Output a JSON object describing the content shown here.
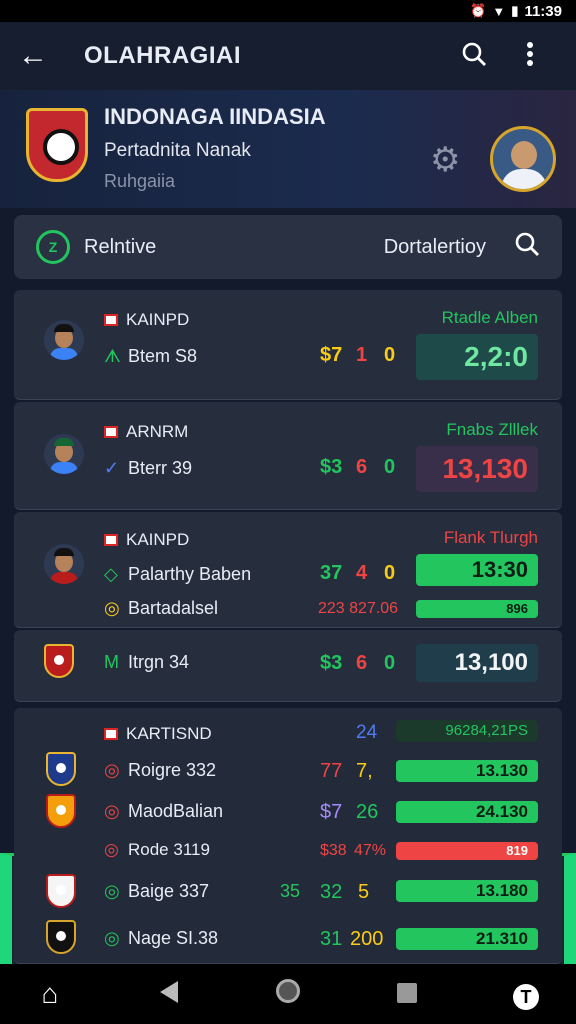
{
  "status_bar": {
    "time": "11:39",
    "icons": [
      "alarm-icon",
      "wifi-icon",
      "battery-icon"
    ]
  },
  "app_bar": {
    "title": "OLAHRAGIAI"
  },
  "header": {
    "name": "INDONAGA IINDASIA",
    "subtitle": "Pertadnita Nanak",
    "subtitle2": "Ruhgaiia"
  },
  "filter": {
    "label": "Relntive",
    "right_label": "Dortalertioy",
    "logo_text": "Z"
  },
  "cards": [
    {
      "tag": "KAINPD",
      "player": "Btem S8",
      "score": [
        "$7",
        "1",
        "0"
      ],
      "status": "Rtadle Alben",
      "badge": "2,2:0"
    },
    {
      "tag": "ARNRM",
      "player": "Bterr 39",
      "score": [
        "$3",
        "6",
        "0"
      ],
      "status": "Fnabs Zlllek",
      "badge": "13,130"
    },
    {
      "tag": "KAINPD",
      "player": "Palarthy Baben",
      "score": [
        "37",
        "4",
        "0"
      ],
      "status": "Flank Tlurgh",
      "badge": "13:30",
      "sub_player": "Bartadalsel",
      "sub_value": "223 827.06",
      "sub_badge": "896"
    },
    {
      "player": "Itrgn 34",
      "score": [
        "$3",
        "6",
        "0"
      ],
      "badge": "13,100"
    }
  ],
  "league": {
    "tag": "KARTISND",
    "header_score": "24",
    "header_badge": "96284,21PS",
    "rows": [
      {
        "player": "Roigre 332",
        "score": [
          "77",
          "7,"
        ],
        "badge": "13.130"
      },
      {
        "player": "MaodBalian",
        "score": [
          "$7",
          "26"
        ],
        "badge": "24.130"
      },
      {
        "player": "Rode 3119",
        "score": [
          "$38",
          "47%"
        ],
        "badge": "819"
      },
      {
        "player": "Baige 337",
        "score": [
          "35",
          "32",
          "5"
        ],
        "badge": "13.180"
      },
      {
        "player": "Nage SI.38",
        "score": [
          "31",
          "200"
        ],
        "badge": "21.310"
      }
    ]
  },
  "colors": {
    "accent_green": "#22c55e",
    "accent_red": "#ef4444",
    "gold": "#e9b530",
    "bg": "#121a2c"
  }
}
